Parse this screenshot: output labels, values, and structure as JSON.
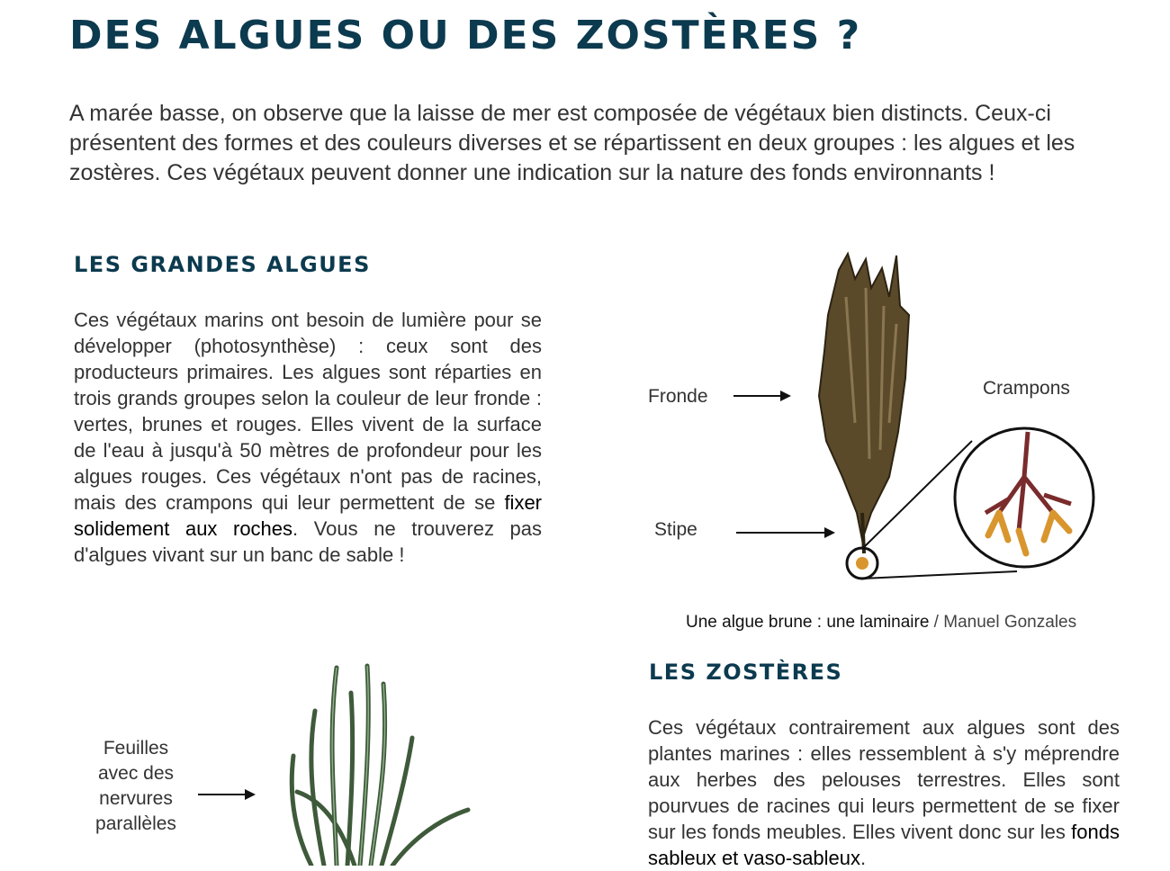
{
  "header": {
    "title": "DES ALGUES OU DES ZOSTÈRES ?"
  },
  "intro": {
    "text": "A marée basse, on observe que la laisse de mer est composée de végétaux bien distincts. Ceux-ci présentent des formes et des couleurs diverses et se répartissent en deux groupes : les algues et les zostères. Ces végétaux peuvent donner une indication sur la nature des fonds environnants !"
  },
  "algues": {
    "title": "LES GRANDES ALGUES",
    "text_before": "Ces végétaux marins ont besoin de lumière pour se développer (photosynthèse) : ceux sont des producteurs primaires. Les algues sont réparties en trois grands groupes selon la couleur de leur fronde : vertes, brunes et rouges. Elles vivent de la surface de l'eau à jusqu'à 50 mètres de profondeur pour les algues rouges. Ces végétaux n'ont pas de racines, mais des crampons qui leur permettent de se ",
    "text_emph": "fixer solidement aux roches",
    "text_after": ". Vous ne trouverez pas d'algues vivant sur un banc de sable !"
  },
  "laminaire": {
    "label_fronde": "Fronde",
    "label_stipe": "Stipe",
    "label_crampons": "Crampons",
    "caption_strong": "Une algue brune : une laminaire",
    "caption_rest": " / Manuel Gonzales"
  },
  "zosteres": {
    "title": "LES ZOSTÈRES",
    "text_before": "Ces végétaux contrairement aux algues sont des plantes marines : elles ressemblent à s'y méprendre aux herbes des pelouses terrestres. Elles sont pourvues de racines qui leurs permettent de se fixer sur les fonds meubles. Elles vivent donc sur les ",
    "text_emph": "fonds sableux et vaso-sableux",
    "text_after": "."
  },
  "zostere_illustration": {
    "label_line1": "Feuilles",
    "label_line2": "avec des",
    "label_line3": "nervures",
    "label_line4": "parallèles"
  },
  "colors": {
    "title": "#0c3a4f",
    "text": "#333333",
    "kelp": "#5a4a2a",
    "holdfast": "#d9962e",
    "seagrass": "#3e5a3a"
  }
}
